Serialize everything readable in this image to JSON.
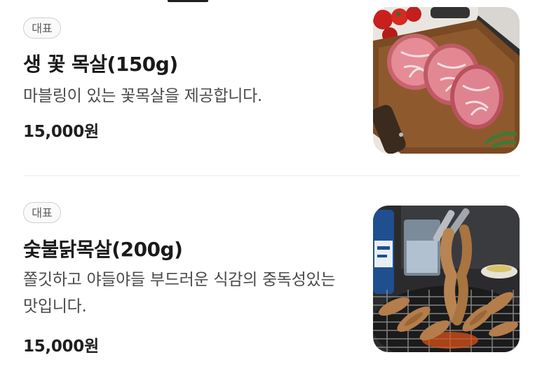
{
  "menu": {
    "items": [
      {
        "badge": "대표",
        "name": "생 꽃 목살(150g)",
        "description": "마블링이 있는 꽃목살을 제공합니다.",
        "price": "15,000원",
        "image_subject": "raw pork neck steaks on wooden board"
      },
      {
        "badge": "대표",
        "name": "숯불닭목살(200g)",
        "description": "쫄깃하고 야들야들 부드러운 식감의 중독성있는 맛입니다.",
        "price": "15,000원",
        "image_subject": "grilled chicken neck on charcoal grill"
      }
    ]
  },
  "colors": {
    "text": "#1f1f1f",
    "subtext": "#4a4a4a",
    "badge_border": "#cfcfcf",
    "divider": "#ececec"
  }
}
